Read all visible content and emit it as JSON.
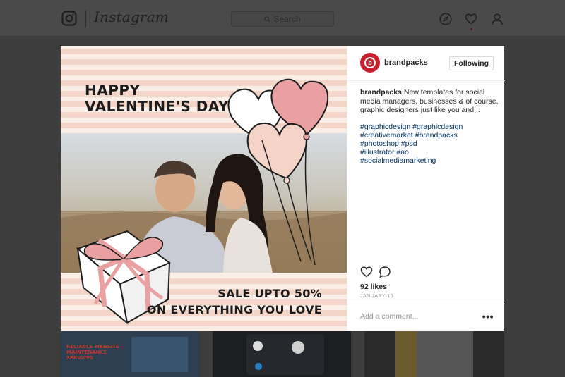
{
  "nav": {
    "brand": "Instagram",
    "search_placeholder": "Search"
  },
  "post": {
    "image": {
      "headline_line1": "HAPPY",
      "headline_line2": "VALENTINE'S DAY",
      "sale_line1": "SALE UPTO 50%",
      "sale_line2": "ON EVERYTHING YOU LOVE"
    },
    "author": {
      "username": "brandpacks",
      "follow_label": "Following"
    },
    "caption": {
      "username": "brandpacks",
      "text": "New templates for social media managers, businesses & of course, graphic designers just like you and I.",
      "hashtags": [
        "#graphicdesign #graphicdesign",
        "#creativemarket #brandpacks",
        "#photoshop #psd",
        "#illustrator #ao",
        "#socialmediamarketing"
      ]
    },
    "likes": "92 likes",
    "date": "JANUARY 16",
    "comment_placeholder": "Add a comment...",
    "more_label": "•••"
  },
  "thumbnails": {
    "first_title": "RELIABLE WEBSITE MAINTENANCE SERVICES"
  },
  "colors": {
    "brand_red": "#c8202f",
    "hashtag_blue": "#003569",
    "stripe_pink": "#f3d6c8"
  }
}
